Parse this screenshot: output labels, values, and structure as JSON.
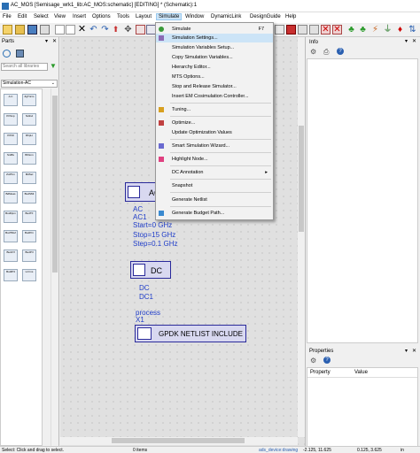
{
  "window": {
    "title": "AC_MOS [Semisage_wrk1_lib:AC_MOS:schematic] [EDITING] * (Schematic):1"
  },
  "menubar": [
    "File",
    "Edit",
    "Select",
    "View",
    "Insert",
    "Options",
    "Tools",
    "Layout",
    "Simulate",
    "Window",
    "DynamicLink",
    "DesignGuide",
    "Help"
  ],
  "simulate_menu": {
    "items": [
      {
        "label": "Simulate",
        "shortcut": "F7"
      },
      {
        "label": "Simulation Settings..."
      },
      {
        "label": "Simulation Variables Setup..."
      },
      {
        "label": "Copy Simulation Variables..."
      },
      {
        "label": "Hierarchy Editor..."
      },
      {
        "label": "MTS Options..."
      },
      {
        "label": "Stop and Release Simulator..."
      },
      {
        "label": "Insert EM Cosimulation Controller..."
      },
      {
        "label": "Tuning..."
      },
      {
        "label": "Optimize..."
      },
      {
        "label": "Update Optimization Values"
      },
      {
        "label": "Smart Simulation Wizard..."
      },
      {
        "label": "Highlight Node..."
      },
      {
        "label": "DC Annotation"
      },
      {
        "label": "Snapshot"
      },
      {
        "label": "Generate Netlist"
      },
      {
        "label": "Generate Budget Path..."
      }
    ]
  },
  "parts": {
    "title": "Parts",
    "search_placeholder": "Search all libraries",
    "library": "Simulation-AC",
    "palette": [
      "A C",
      "ZgTricm",
      "PrtSnp",
      "NdInd",
      "PrPdl",
      "RhpLt",
      "SntBx",
      "B/Nom",
      "ZoPhm",
      "MdSel",
      "BdMeas",
      "BudSMt",
      "BudNpm",
      "BudTF",
      "BudTRef",
      "BudPrn",
      "BudVrf",
      "BudPrl",
      "BudIP3",
      "Lrrrms"
    ]
  },
  "schematic": {
    "ac_block": {
      "label": "AC",
      "lines": [
        "AC",
        "AC1",
        "Start=0 GHz",
        "Stop=15 GHz",
        "Step=0.1 GHz"
      ]
    },
    "dc_block": {
      "label": "DC",
      "lines": [
        "DC",
        "DC1"
      ]
    },
    "netlist_block": {
      "label": "GPDK NETLIST INCLUDE",
      "lines": [
        "process",
        "X1"
      ]
    }
  },
  "info_panel": {
    "title": "Info"
  },
  "properties_panel": {
    "title": "Properties",
    "columns": [
      "Property",
      "Value"
    ]
  },
  "status": {
    "hint": "Select: Click and drag to select.",
    "items": "0 items",
    "layer": "ads_device:drawing",
    "coords": "-2.125, 11.625",
    "delta": "0.125, 3.625",
    "units": "in"
  },
  "colors": {
    "menu_highlight": "#cce4f7",
    "component_blue": "#1e3cc8",
    "canvas": "#e0e0e0"
  }
}
